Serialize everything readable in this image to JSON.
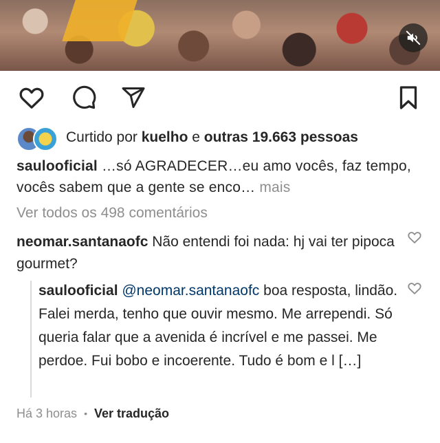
{
  "post": {
    "video": {
      "muted_icon": "speaker-muted-icon"
    },
    "actions": {
      "like_icon": "heart-icon",
      "comment_icon": "comment-icon",
      "share_icon": "send-icon",
      "save_icon": "bookmark-icon"
    },
    "likes": {
      "prefix": "Curtido por",
      "user": "kuelho",
      "connector": "e",
      "others": "outras 19.663 pessoas"
    },
    "caption": {
      "username": "saulooficial",
      "text": " …só AGRADECER…eu amo vocês, faz tempo, vocês sabem que a gente se enco…",
      "more": " mais"
    },
    "view_all_comments": "Ver todos os 498 comentários",
    "comment": {
      "username": "neomar.santanaofc",
      "text": " Não entendi foi nada: hj vai ter pipoca gourmet?"
    },
    "reply": {
      "username": "saulooficial",
      "mention": " @neomar.santanaofc",
      "text": " boa resposta, lindão. Falei merda, tenho que ouvir mesmo. Me arrependi. Só queria falar que a avenida é incrível e me passei. Me perdoe. Fui bobo e incoerente. Tudo é bom e l […]"
    },
    "footer": {
      "time": "Há 3 horas",
      "separator": "•",
      "translate": "Ver tradução"
    }
  }
}
